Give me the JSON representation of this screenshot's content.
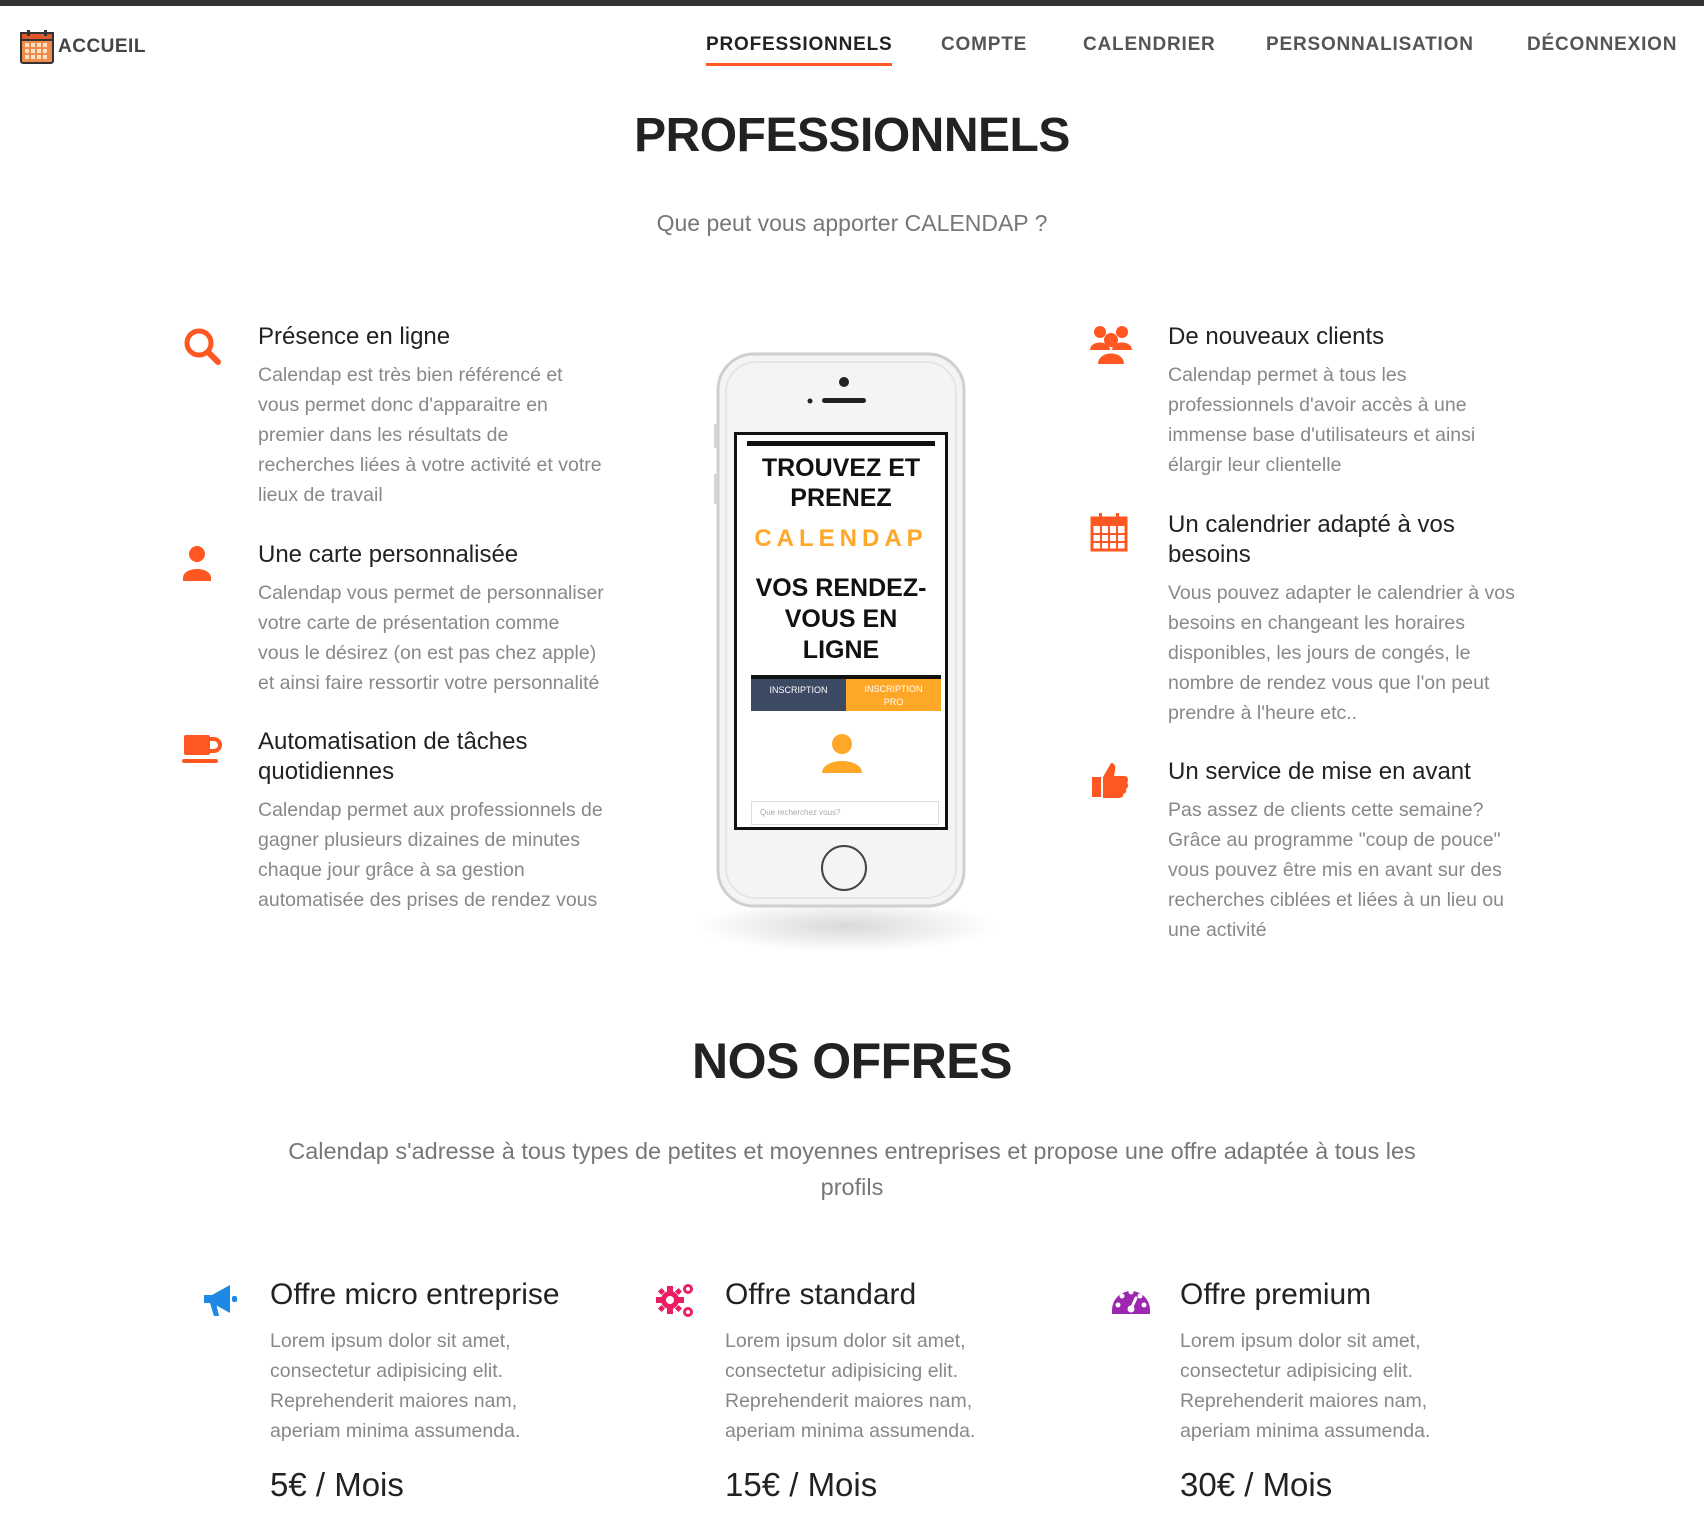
{
  "nav": {
    "brand_label": "ACCUEIL",
    "items": [
      {
        "label": "PROFESSIONNELS"
      },
      {
        "label": "COMPTE"
      },
      {
        "label": "CALENDRIER"
      },
      {
        "label": "PERSONNALISATION"
      },
      {
        "label": "DÉCONNEXION"
      }
    ],
    "active_color": "#ff5722"
  },
  "hero": {
    "title": "PROFESSIONNELS",
    "subtitle": "Que peut vous apporter CALENDAP ?"
  },
  "features_left": [
    {
      "icon": "search-icon",
      "title": "Présence en ligne",
      "desc": [
        "Calendap est très bien référencé et",
        "vous permet donc d'apparaitre en",
        "premier dans les résultats de",
        "recherches liées à votre activité et votre",
        "lieux de travail"
      ]
    },
    {
      "icon": "user-icon",
      "title": "Une carte personnalisée",
      "desc": [
        "Calendap vous permet de personnaliser",
        "votre carte de présentation comme",
        "vous le désirez (on est pas chez apple)",
        "et ainsi faire ressortir votre personnalité"
      ]
    },
    {
      "icon": "coffee-icon",
      "title": [
        "Automatisation de tâches",
        "quotidiennes"
      ],
      "desc": [
        "Calendap permet aux professionnels de",
        "gagner plusieurs dizaines de minutes",
        "chaque jour grâce à sa gestion",
        "automatisée des prises de rendez vous"
      ]
    }
  ],
  "features_right": [
    {
      "icon": "users-icon",
      "title": "De nouveaux clients",
      "desc": [
        "Calendap permet à tous les",
        "professionnels d'avoir accès à une",
        "immense base d'utilisateurs et ainsi",
        "élargir leur clientelle"
      ]
    },
    {
      "icon": "calendar-icon",
      "title": [
        "Un calendrier adapté à vos",
        "besoins"
      ],
      "desc": [
        "Vous pouvez adapter le calendrier à vos",
        "besoins en changeant les horaires",
        "disponibles, les jours de congés, le",
        "nombre de rendez vous que l'on peut",
        "prendre à l'heure etc.."
      ]
    },
    {
      "icon": "thumbs-up-icon",
      "title": "Un service de mise en avant",
      "desc": [
        "Pas assez de clients cette semaine?",
        "Grâce au programme \"coup de pouce\"",
        "vous pouvez être mis en avant sur des",
        "recherches ciblées et liées à un lieu ou",
        "une activité"
      ]
    }
  ],
  "phone": {
    "line1": "TROUVEZ ET",
    "line2": "PRENEZ",
    "brand": "CALENDAP",
    "line3": "VOS RENDEZ-",
    "line4": "VOUS EN",
    "line5": "LIGNE",
    "btn1": "INSCRIPTION",
    "btn2_a": "INSCRIPTION",
    "btn2_b": "PRO",
    "search_placeholder": "Que recherchez vous?"
  },
  "offers_section": {
    "title": "NOS OFFRES",
    "subtitle_line1": "Calendap s'adresse à tous types de petites et moyennes entreprises et propose une offre adaptée à tous les",
    "subtitle_line2": "profils"
  },
  "offers": [
    {
      "icon": "megaphone-icon",
      "color": "#1e88e5",
      "title": "Offre micro entreprise",
      "desc": [
        "Lorem ipsum dolor sit amet,",
        "consectetur adipisicing elit.",
        "Reprehenderit maiores nam,",
        "aperiam minima assumenda."
      ],
      "price": "5€ / Mois"
    },
    {
      "icon": "gears-icon",
      "color": "#e91e63",
      "title": "Offre standard",
      "desc": [
        "Lorem ipsum dolor sit amet,",
        "consectetur adipisicing elit.",
        "Reprehenderit maiores nam,",
        "aperiam minima assumenda."
      ],
      "price": "15€ / Mois"
    },
    {
      "icon": "dashboard-icon",
      "color": "#9c27b0",
      "title": "Offre premium",
      "desc": [
        "Lorem ipsum dolor sit amet,",
        "consectetur adipisicing elit.",
        "Reprehenderit maiores nam,",
        "aperiam minima assumenda."
      ],
      "price": "30€ / Mois"
    }
  ],
  "accent_color": "#ff5722"
}
